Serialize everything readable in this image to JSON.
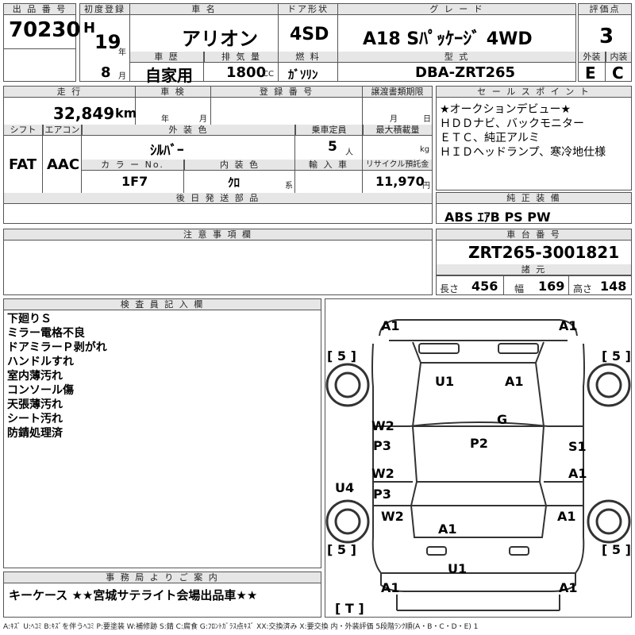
{
  "header": {
    "lot_label": "出 品 番 号",
    "lot_no": "70230",
    "first_reg_label": "初度登録",
    "era": "H",
    "year": "19",
    "year_unit": "年",
    "month": "8",
    "month_unit": "月",
    "car_name_label": "車 名",
    "car_name": "アリオン",
    "door_label": "ドア形状",
    "door": "4SD",
    "grade_label": "グ レ ー ド",
    "grade": "A18 Sﾊﾟｯｹｰｼﾞ 4WD",
    "score_label": "評価点",
    "score": "3",
    "history_label": "車 歴",
    "history": "自家用",
    "displacement_label": "排 気 量",
    "displacement": "1800",
    "displacement_unit": "CC",
    "fuel_label": "燃 料",
    "fuel": "ｶﾞｿﾘﾝ",
    "model_label": "型 式",
    "model": "DBA-ZRT265",
    "ext_label": "外装",
    "ext": "E",
    "int_label": "内装",
    "int": "C"
  },
  "row2": {
    "mileage_label": "走 行",
    "mileage": "32,849",
    "mileage_unit": "km",
    "inspection_label": "車 検",
    "insp_year_unit": "年",
    "insp_month_unit": "月",
    "regno_label": "登 録 番 号",
    "transfer_label": "譲渡書類期限",
    "transfer_month_unit": "月",
    "transfer_day_unit": "日",
    "shift_label": "シフト",
    "shift": "FAT",
    "ac_label": "エアコン",
    "ac": "AAC",
    "color_label": "外 装 色",
    "color": "ｼﾙﾊﾞｰ",
    "capacity_label": "乗車定員",
    "capacity": "5",
    "capacity_unit": "人",
    "load_label": "最大積載量",
    "load_unit": "kg",
    "colorno_label": "カ ラ ー No.",
    "colorno": "1F7",
    "interior_label": "内 装 色",
    "interior": "ｸﾛ",
    "interior_unit": "系",
    "import_label": "輸 入 車",
    "recycle_label": "リサイクル預託金",
    "recycle": "11,970",
    "recycle_unit": "円",
    "later_label": "後 日 発 送 部 品"
  },
  "sales": {
    "label": "セ ー ル ス ポ イ ン ト",
    "lines": [
      "★オークションデビュー★",
      "ＨＤＤナビ、バックモニター",
      "ＥＴＣ、純正アルミ",
      "ＨＩＤヘッドランプ、寒冷地仕様"
    ]
  },
  "equip": {
    "label": "純 正 装 備",
    "value": "ABS ｴｱB PS PW"
  },
  "notes": {
    "label": "注 意 事 項 欄"
  },
  "chassis": {
    "label": "車 台 番 号",
    "value": "ZRT265-3001821",
    "dims_label": "諸 元",
    "length_label": "長さ",
    "length": "456",
    "width_label": "幅",
    "width": "169",
    "height_label": "高さ",
    "height": "148"
  },
  "inspector": {
    "label": "検 査 員 記 入 欄",
    "lines": [
      "下廻りＳ",
      "ミラー電格不良",
      "ドアミラーＰ剥がれ",
      "ハンドルすれ",
      "室内薄汚れ",
      "コンソール傷",
      "天張薄汚れ",
      "シート汚れ",
      "防錆処理済"
    ]
  },
  "office": {
    "label": "事 務 局 よ り ご 案 内",
    "value": "キーケース ★★宮城サテライト会場出品車★★"
  },
  "diagram": {
    "tl": "A1",
    "tr": "A1",
    "bl": "A1",
    "br": "A1",
    "tire_lf": "5",
    "tire_rf": "5",
    "tire_lr": "5",
    "tire_rr": "5",
    "trunk": "T",
    "hood_l": "U1",
    "hood_r": "A1",
    "glass": "G",
    "door_lf1": "W2",
    "door_lf2": "P3",
    "door_lr1": "W2",
    "door_lr2": "P3",
    "door_rf": "S1",
    "door_rr": "A1",
    "roof": "P2",
    "rocker_l": "U4",
    "qtr_l": "W2",
    "qtr_r": "A1",
    "trunk_lid": "A1",
    "rear_bumper": "U1"
  },
  "legend": "A:ｷｽﾞ U:ﾍｺﾐ B:ｷｽﾞを伴うﾍｺﾐ P:要塗装 W:補修跡 S:錆 C:腐食 G:ﾌﾛﾝﾄｶﾞﾗｽ点ｷｽﾞ XX:交換済み X:要交換 内・外装評価 5段階ﾗﾝｸ順(A・B・C・D・E) 1"
}
